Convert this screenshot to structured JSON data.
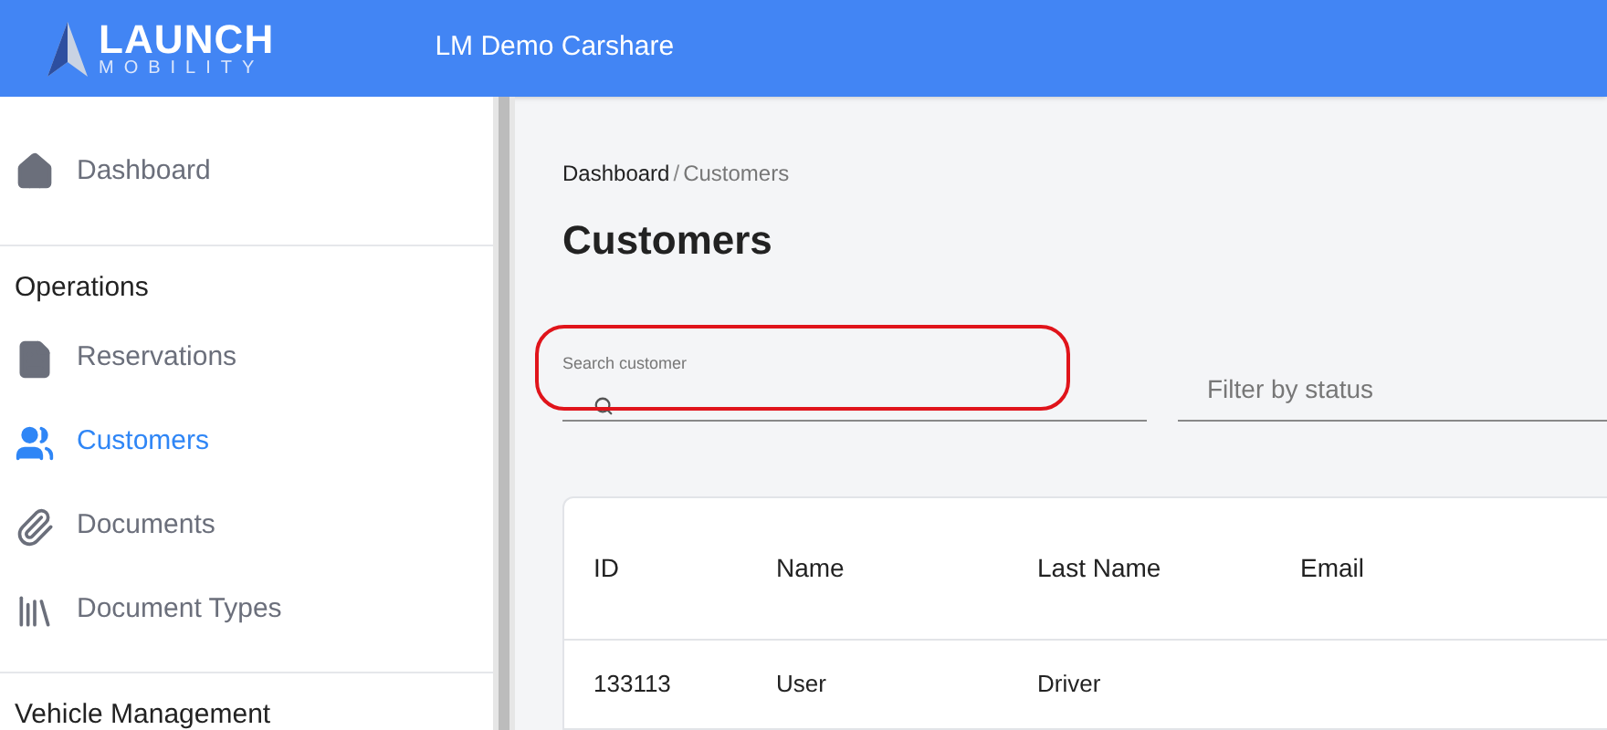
{
  "header": {
    "logo_title": "LAUNCH",
    "logo_subtitle": "MOBILITY",
    "org_name": "LM Demo Carshare"
  },
  "sidebar": {
    "top_items": [
      {
        "label": "Dashboard",
        "kind": "home",
        "selected": false
      }
    ],
    "sections": [
      {
        "title": "Operations",
        "items": [
          {
            "label": "Reservations",
            "kind": "file",
            "selected": false
          },
          {
            "label": "Customers",
            "kind": "people",
            "selected": true
          },
          {
            "label": "Documents",
            "kind": "clip",
            "selected": false
          },
          {
            "label": "Document Types",
            "kind": "library",
            "selected": false
          }
        ]
      },
      {
        "title": "Vehicle Management"
      }
    ]
  },
  "breadcrumb": [
    {
      "label": "Dashboard"
    },
    {
      "label": "Customers"
    }
  ],
  "breadcrumb_separator": "/",
  "page_title": "Customers",
  "search": {
    "label": "Search customer",
    "highlighted": true
  },
  "status_filter": {
    "placeholder": "Filter by status"
  },
  "table": {
    "columns": [
      "ID",
      "Name",
      "Last Name",
      "Email"
    ],
    "rows": [
      [
        "133113",
        "User",
        "Driver",
        ""
      ]
    ]
  }
}
